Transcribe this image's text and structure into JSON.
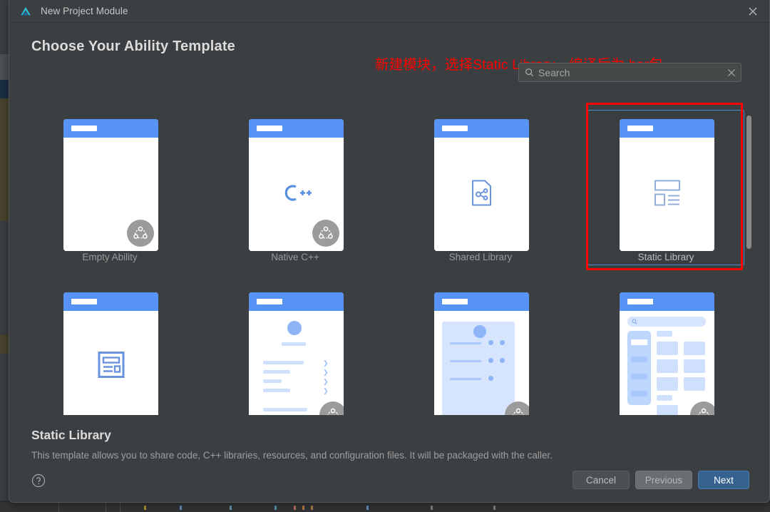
{
  "window": {
    "title": "New Project Module",
    "logo_icon": "deveco-logo-icon",
    "close_icon": "close-icon"
  },
  "page": {
    "title": "Choose Your Ability Template",
    "annotation": "新建模块，选择Static Library，编译后为.har包",
    "annotation_color": "#ff0000"
  },
  "search": {
    "placeholder": "Search",
    "value": "",
    "icon": "search-icon",
    "clear_icon": "clear-icon"
  },
  "templates": [
    {
      "label": "Empty Ability",
      "icon": "blank-page-icon",
      "selected": false,
      "badge": true
    },
    {
      "label": "Native C++",
      "icon": "cpp-icon",
      "selected": false,
      "badge": true
    },
    {
      "label": "Shared Library",
      "icon": "shared-document-icon",
      "selected": false,
      "badge": false
    },
    {
      "label": "Static Library",
      "icon": "static-library-list-icon",
      "selected": true,
      "badge": false
    },
    {
      "label": "",
      "icon": "card-layout-icon",
      "selected": false,
      "badge": false
    },
    {
      "label": "",
      "icon": "profile-list-mock",
      "selected": false,
      "badge": true
    },
    {
      "label": "",
      "icon": "feature-list-mock",
      "selected": false,
      "badge": true
    },
    {
      "label": "",
      "icon": "grid-catalog-mock",
      "selected": false,
      "badge": true
    }
  ],
  "description": {
    "title": "Static Library",
    "text": "This template allows you to share code, C++ libraries, resources, and configuration files. It will be packaged with the caller."
  },
  "footer": {
    "help_icon": "help-icon",
    "cancel_label": "Cancel",
    "previous_label": "Previous",
    "next_label": "Next",
    "next_color": "#36628f"
  },
  "scrollbar": {
    "name": "template-grid-scrollbar"
  }
}
